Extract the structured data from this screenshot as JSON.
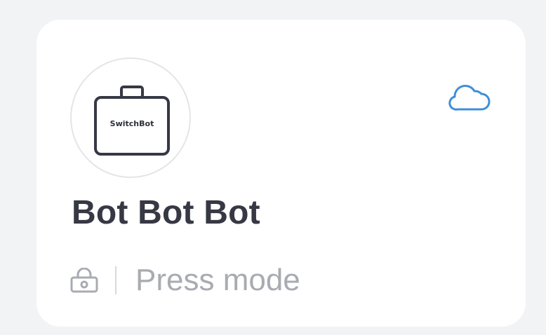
{
  "device": {
    "brand": "SwitchBot",
    "name": "Bot Bot Bot",
    "mode": "Press mode",
    "icons": {
      "device": "switchbot-bot-icon",
      "cloud": "cloud-icon",
      "lock": "lock-icon"
    }
  },
  "colors": {
    "page_background": "#f2f3f5",
    "card_background": "#ffffff",
    "title_text": "#363944",
    "muted_text": "#a9abb2",
    "cloud_accent": "#3f8fd8"
  }
}
